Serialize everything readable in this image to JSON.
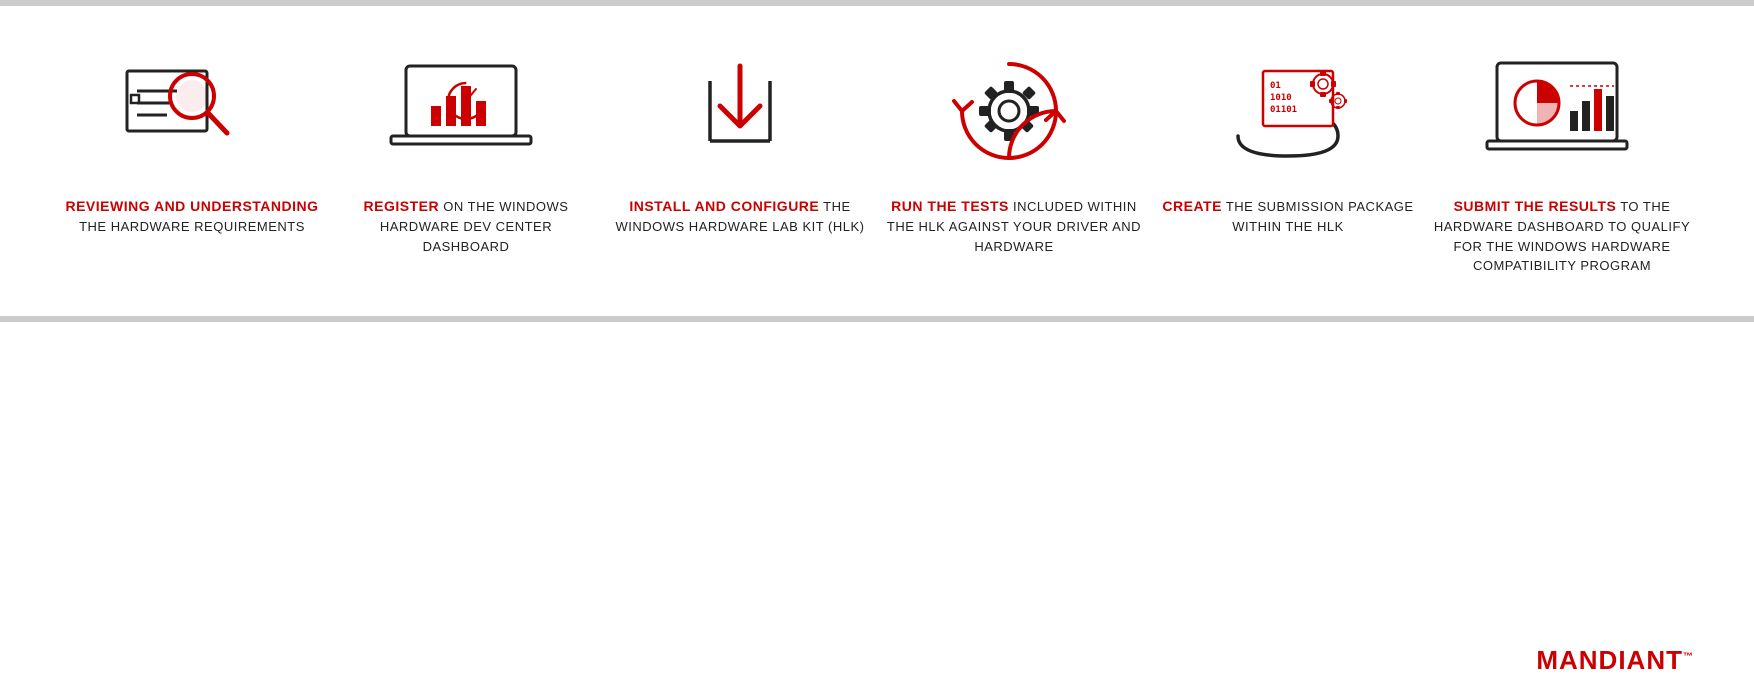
{
  "steps": [
    {
      "id": "step-1",
      "highlight": "REVIEWING AND UNDERSTANDING",
      "rest": "THE HARDWARE REQUIREMENTS"
    },
    {
      "id": "step-2",
      "highlight": "REGISTER",
      "rest": "ON THE WINDOWS HARDWARE DEV CENTER DASHBOARD"
    },
    {
      "id": "step-3",
      "highlight": "INSTALL AND CONFIGURE",
      "rest": "THE WINDOWS HARDWARE LAB KIT (HLK)"
    },
    {
      "id": "step-4",
      "highlight": "RUN THE TESTS",
      "rest": "INCLUDED WITHIN THE HLK AGAINST YOUR DRIVER AND HARDWARE"
    },
    {
      "id": "step-5",
      "highlight": "CREATE",
      "rest": "THE SUBMISSION PACKAGE WITHIN THE HLK"
    },
    {
      "id": "step-6",
      "highlight": "SUBMIT THE RESULTS",
      "rest": "TO THE HARDWARE DASHBOARD TO QUALIFY FOR THE WINDOWS HARDWARE COMPATIBILITY PROGRAM"
    }
  ],
  "footer": {
    "brand": "MANDIANT",
    "brand_m": "M",
    "brand_rest": "ANDIANT"
  }
}
